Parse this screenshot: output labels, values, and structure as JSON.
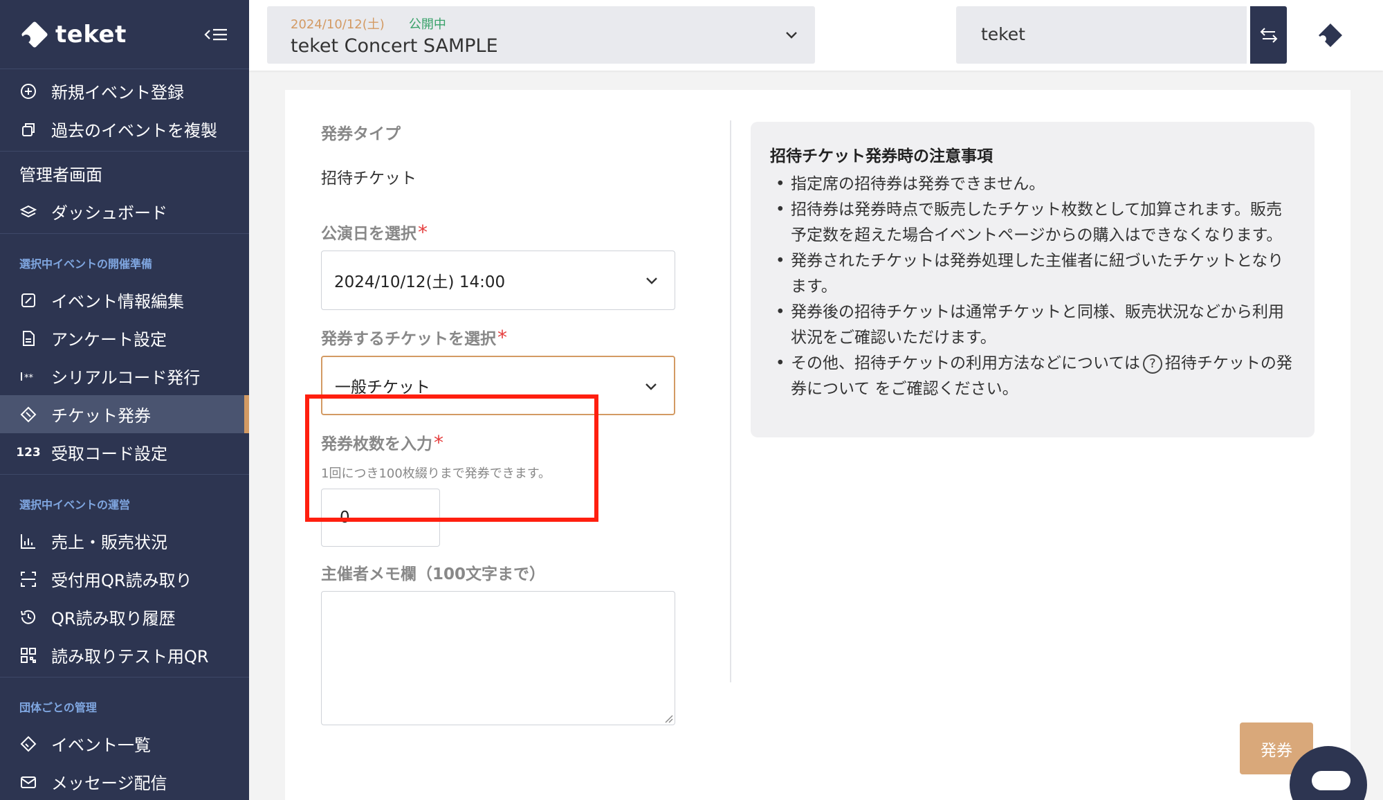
{
  "brand": {
    "name": "teket"
  },
  "sidebar": {
    "top_items": [
      {
        "label": "新規イベント登録",
        "icon": "plus-circle-icon"
      },
      {
        "label": "過去のイベントを複製",
        "icon": "copy-icon"
      }
    ],
    "admin_heading": "管理者画面",
    "dashboard": {
      "label": "ダッシュボード",
      "icon": "layers-icon"
    },
    "prep_section": "選択中イベントの開催準備",
    "prep_items": [
      {
        "label": "イベント情報編集",
        "icon": "edit-icon"
      },
      {
        "label": "アンケート設定",
        "icon": "document-icon"
      },
      {
        "label": "シリアルコード発行",
        "icon": "serial-code-icon"
      },
      {
        "label": "チケット発券",
        "icon": "ticket-icon",
        "active": true
      },
      {
        "label": "受取コード設定",
        "icon": "123"
      }
    ],
    "ops_section": "選択中イベントの運営",
    "ops_items": [
      {
        "label": "売上・販売状況",
        "icon": "bar-chart-icon"
      },
      {
        "label": "受付用QR読み取り",
        "icon": "qr-scan-icon"
      },
      {
        "label": "QR読み取り履歴",
        "icon": "history-icon"
      },
      {
        "label": "読み取りテスト用QR",
        "icon": "qr-code-icon"
      }
    ],
    "org_section": "団体ごとの管理",
    "org_items": [
      {
        "label": "イベント一覧",
        "icon": "ticket-outline-icon"
      },
      {
        "label": "メッセージ配信",
        "icon": "mail-icon"
      }
    ]
  },
  "topbar": {
    "event_date": "2024/10/12(土)",
    "event_status": "公開中",
    "event_name": "teket Concert SAMPLE",
    "org_name": "teket"
  },
  "form": {
    "ticket_type_label": "発券タイプ",
    "ticket_type_value": "招待チケット",
    "date_label": "公演日を選択",
    "date_value": "2024/10/12(土) 14:00",
    "ticket_label": "発券するチケットを選択",
    "ticket_value": "一般チケット",
    "count_label": "発券枚数を入力",
    "count_hint": "1回につき100枚綴りまで発券できます。",
    "count_value": "0",
    "memo_label": "主催者メモ欄（100文字まで）",
    "required_mark": "*"
  },
  "notice": {
    "title": "招待チケット発券時の注意事項",
    "items": [
      "指定席の招待券は発券できません。",
      "招待券は発券時点で販売したチケット枚数として加算されます。販売予定数を超えた場合イベントページからの購入はできなくなります。",
      "発券されたチケットは発券処理した主催者に紐づいたチケットとなります。",
      "発券後の招待チケットは通常チケットと同様、販売状況などから利用状況をご確認いただけます。"
    ],
    "last_item_prefix": "その他、招待チケットの利用方法などについては",
    "last_item_link": "招待チケットの発券について",
    "last_item_suffix": "をご確認ください。",
    "help_glyph": "?"
  },
  "actions": {
    "issue_label": "発券"
  },
  "colors": {
    "sidebar_bg": "#2d3551",
    "accent": "#d39a63",
    "status_green": "#38a169",
    "highlight_red": "#ff1f0f"
  }
}
